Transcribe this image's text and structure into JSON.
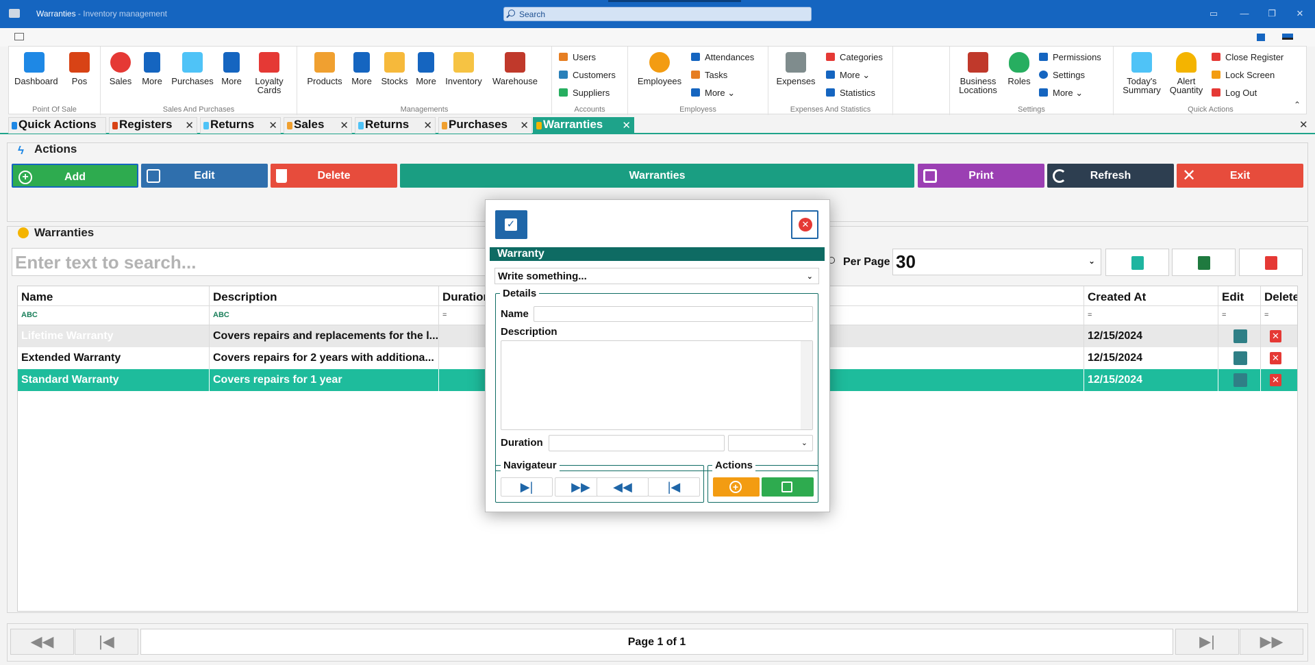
{
  "app": {
    "title": "Warranties",
    "subtitle": " - Inventory management",
    "search_placeholder": "Search"
  },
  "ribbon": {
    "groups": [
      {
        "title": "Point Of Sale"
      },
      {
        "title": "Sales And Purchases"
      },
      {
        "title": "Managements"
      },
      {
        "title": "Accounts"
      },
      {
        "title": "Employess"
      },
      {
        "title": "Expenses And Statistics"
      },
      {
        "title": "Settings"
      },
      {
        "title": "Quick Actions"
      }
    ],
    "items": {
      "dashboard": "Dashboard",
      "pos": "Pos",
      "sales": "Sales",
      "more1": "More",
      "purchases": "Purchases",
      "more2": "More",
      "loyalty1": "Loyalty",
      "loyalty2": "Cards",
      "products": "Products",
      "more3": "More",
      "stocks": "Stocks",
      "more4": "More",
      "inventory": "Inventory",
      "warehouse": "Warehouse",
      "users": "Users",
      "customers": "Customers",
      "suppliers": "Suppliers",
      "employees": "Employees",
      "attendances": "Attendances",
      "tasks": "Tasks",
      "more5": "More",
      "expenses": "Expenses",
      "categories": "Categories",
      "more6": "More",
      "statistics": "Statistics",
      "business1": "Business",
      "business2": "Locations",
      "roles": "Roles",
      "permissions": "Permissions",
      "settings": "Settings",
      "more7": "More",
      "todays1": "Today's",
      "todays2": "Summary",
      "alert1": "Alert",
      "alert2": "Quantity",
      "close_register": "Close Register",
      "lock_screen": "Lock Screen",
      "log_out": "Log Out"
    }
  },
  "tabs": [
    {
      "label": "Quick Actions"
    },
    {
      "label": "Registers"
    },
    {
      "label": "Returns"
    },
    {
      "label": "Sales"
    },
    {
      "label": "Returns"
    },
    {
      "label": "Purchases"
    },
    {
      "label": "Warranties"
    }
  ],
  "actions_panel": {
    "title": "Actions",
    "buttons": {
      "add": "Add",
      "edit": "Edit",
      "delete": "Delete",
      "warranties": "Warranties",
      "print": "Print",
      "refresh": "Refresh",
      "exit": "Exit"
    }
  },
  "warranties_panel": {
    "title": "Warranties",
    "search_placeholder": "Enter text to search...",
    "per_page_label": "Per Page",
    "per_page_value": "30"
  },
  "grid": {
    "columns": [
      "Name",
      "Description",
      "Duration",
      "Created At",
      "Edit",
      "Delete"
    ],
    "filters": [
      "ABC",
      "ABC",
      "=",
      "=",
      "=",
      "="
    ],
    "rows": [
      {
        "name": "Lifetime Warranty",
        "description": "Covers repairs and replacements for the l...",
        "created": "12/15/2024"
      },
      {
        "name": "Extended Warranty",
        "description": "Covers repairs for 2 years with additiona...",
        "created": "12/15/2024"
      },
      {
        "name": "Standard Warranty",
        "description": "Covers repairs for 1 year",
        "created": "12/15/2024"
      }
    ]
  },
  "pager": {
    "text": "Page 1 of 1"
  },
  "dialog": {
    "header": "Warranty",
    "select_placeholder": "Write something...",
    "details_legend": "Details",
    "name_label": "Name",
    "description_label": "Description",
    "duration_label": "Duration",
    "navigator_legend": "Navigateur",
    "actions_legend": "Actions"
  },
  "colors": {
    "titlebar": "#1565c0",
    "accent_teal": "#1ea38a",
    "add_green": "#2eab4f",
    "edit_blue": "#2f6fad",
    "delete_red": "#e74c3c",
    "print_purple": "#9b3fb3",
    "refresh_dark": "#2d3e50",
    "dialog_header": "#0e6b63"
  }
}
